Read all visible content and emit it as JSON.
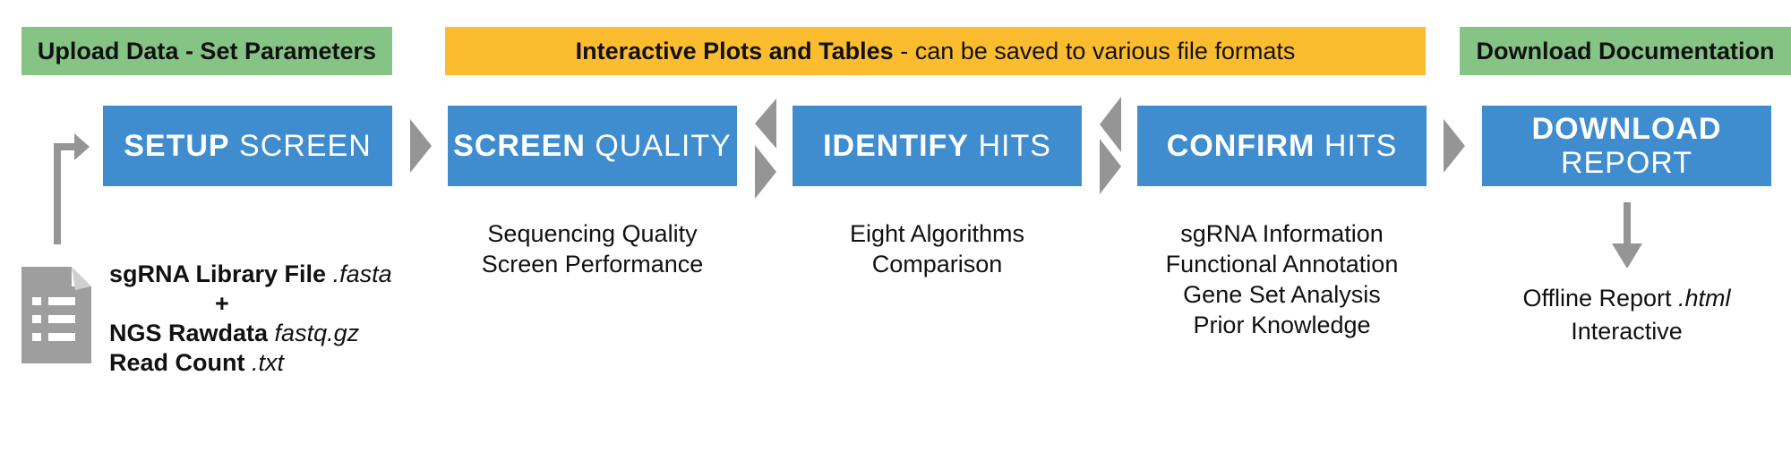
{
  "banners": {
    "upload": "Upload Data - Set Parameters",
    "plots_bold": "Interactive Plots and Tables",
    "plots_rest": " - can be saved to various file formats",
    "download": "Download Documentation"
  },
  "steps": [
    {
      "strong": "SETUP",
      "light": "SCREEN"
    },
    {
      "strong": "SCREEN",
      "light": "QUALITY"
    },
    {
      "strong": "IDENTIFY",
      "light": "HITS"
    },
    {
      "strong": "CONFIRM",
      "light": "HITS"
    },
    {
      "strong": "DOWNLOAD",
      "light": "REPORT"
    }
  ],
  "input_files": {
    "library_name": "sgRNA Library File",
    "library_ext": " .fasta",
    "plus": "+",
    "ngs_name": "NGS Rawdata",
    "ngs_ext": " fastq.gz",
    "count_name": "Read Count",
    "count_ext": " .txt"
  },
  "descriptions": {
    "quality": [
      "Sequencing Quality",
      "Screen Performance"
    ],
    "identify": [
      "Eight Algorithms",
      "Comparison"
    ],
    "confirm": [
      "sgRNA Information",
      "Functional Annotation",
      "Gene Set Analysis",
      "Prior Knowledge"
    ]
  },
  "report": {
    "name": "Offline Report",
    "ext": " .html",
    "line2": "Interactive"
  },
  "colors": {
    "green": "#85c485",
    "yellow": "#fbbc2f",
    "blue": "#3f8ccf",
    "arrow_gray": "#959595"
  },
  "icons": [
    "document-icon",
    "bent-arrow-icon",
    "chevron-right-icon",
    "chevron-left-icon",
    "down-arrow-icon"
  ]
}
